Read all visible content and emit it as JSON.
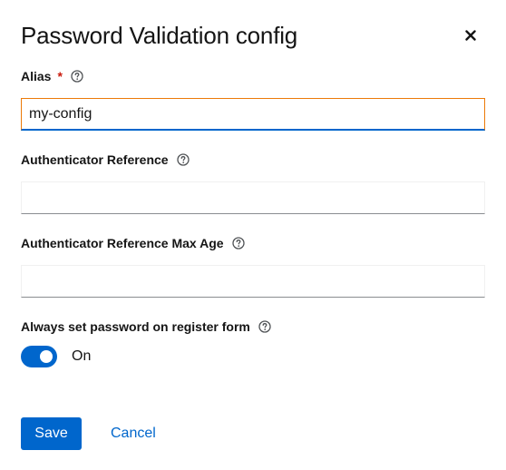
{
  "modal": {
    "title": "Password Validation config",
    "close_icon": "close-icon"
  },
  "form": {
    "alias": {
      "label": "Alias",
      "required_mark": "*",
      "value": "my-config",
      "help_icon": "help-icon"
    },
    "authenticator_reference": {
      "label": "Authenticator Reference",
      "value": "",
      "help_icon": "help-icon"
    },
    "authenticator_reference_max_age": {
      "label": "Authenticator Reference Max Age",
      "value": "",
      "help_icon": "help-icon"
    },
    "always_set_password": {
      "label": "Always set password on register form",
      "toggle_state_label": "On",
      "checked": true,
      "help_icon": "help-icon"
    }
  },
  "actions": {
    "save_label": "Save",
    "cancel_label": "Cancel"
  },
  "colors": {
    "primary": "#0066cc",
    "required": "#c9190b",
    "focus_border": "#ec7a08"
  }
}
